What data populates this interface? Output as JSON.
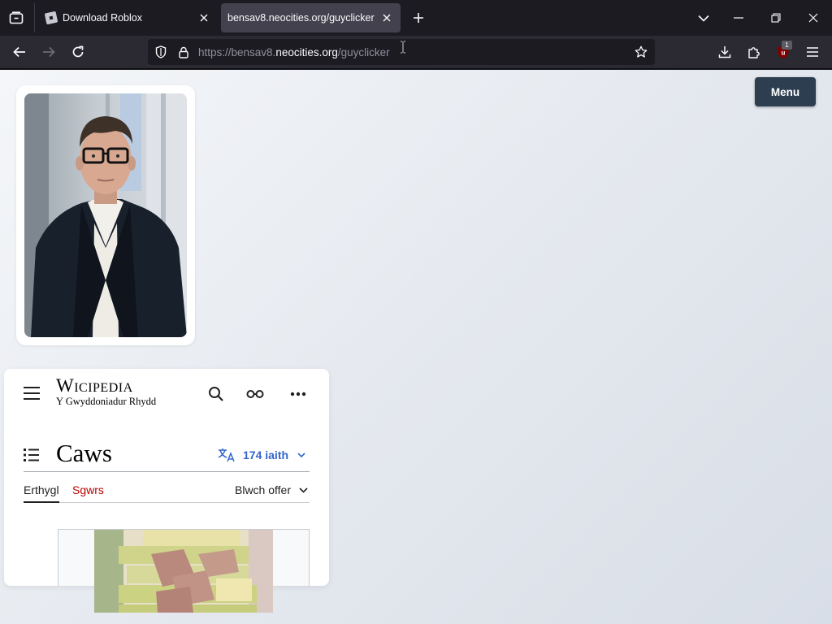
{
  "tabs": [
    {
      "title": "Download Roblox",
      "active": false
    },
    {
      "title": "bensav8.neocities.org/guyclicker",
      "active": true
    }
  ],
  "urlbar": {
    "scheme": "https://bensav8.",
    "domain": "neocities.org",
    "path": "/guyclicker"
  },
  "toolbar": {
    "extension_badge": "1"
  },
  "page": {
    "menu_label": "Menu"
  },
  "wiki": {
    "logo_title": "Wicipedia",
    "logo_tagline": "Y Gwyddoniadur Rhydd",
    "title": "Caws",
    "languages": "174 iaith",
    "tab_article": "Erthygl",
    "tab_talk": "Sgwrs",
    "tools": "Blwch offer"
  },
  "colors": {
    "tab_bg": "#1c1b22",
    "nav_bg": "#2b2a33",
    "active_tab": "#42414d",
    "menu_button": "#2c3e50",
    "wiki_link": "#3366cc",
    "wiki_talk": "#ba0000"
  }
}
